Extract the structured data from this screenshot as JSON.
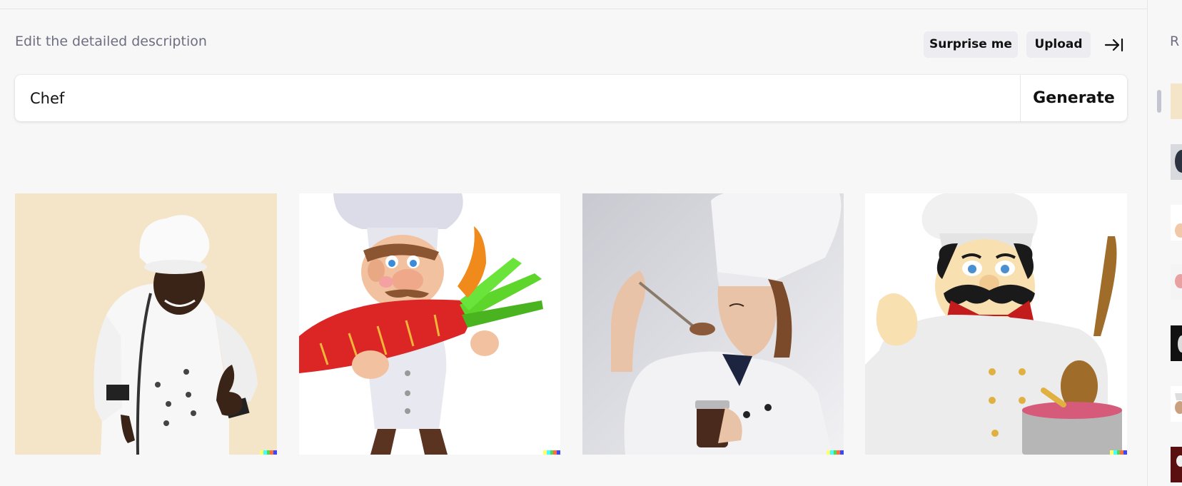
{
  "prompt_section": {
    "label": "Edit the detailed description",
    "surprise_label": "Surprise me",
    "upload_label": "Upload",
    "input_value": "Chef",
    "generate_label": "Generate"
  },
  "results": [
    {
      "subject": "chef-photo-thumbs-up"
    },
    {
      "subject": "cartoon-chef-carrot"
    },
    {
      "subject": "chef-tasting-spoon"
    },
    {
      "subject": "cartoon-chef-mustache"
    }
  ],
  "signature_colors": [
    "#ffff66",
    "#42ffff",
    "#51da4c",
    "#ff6e3c",
    "#3c46ff"
  ],
  "history": {
    "label": "R"
  },
  "colors": {
    "background": "#f7f7f8",
    "chip": "#ececf1",
    "muted_text": "#6e6e80"
  }
}
